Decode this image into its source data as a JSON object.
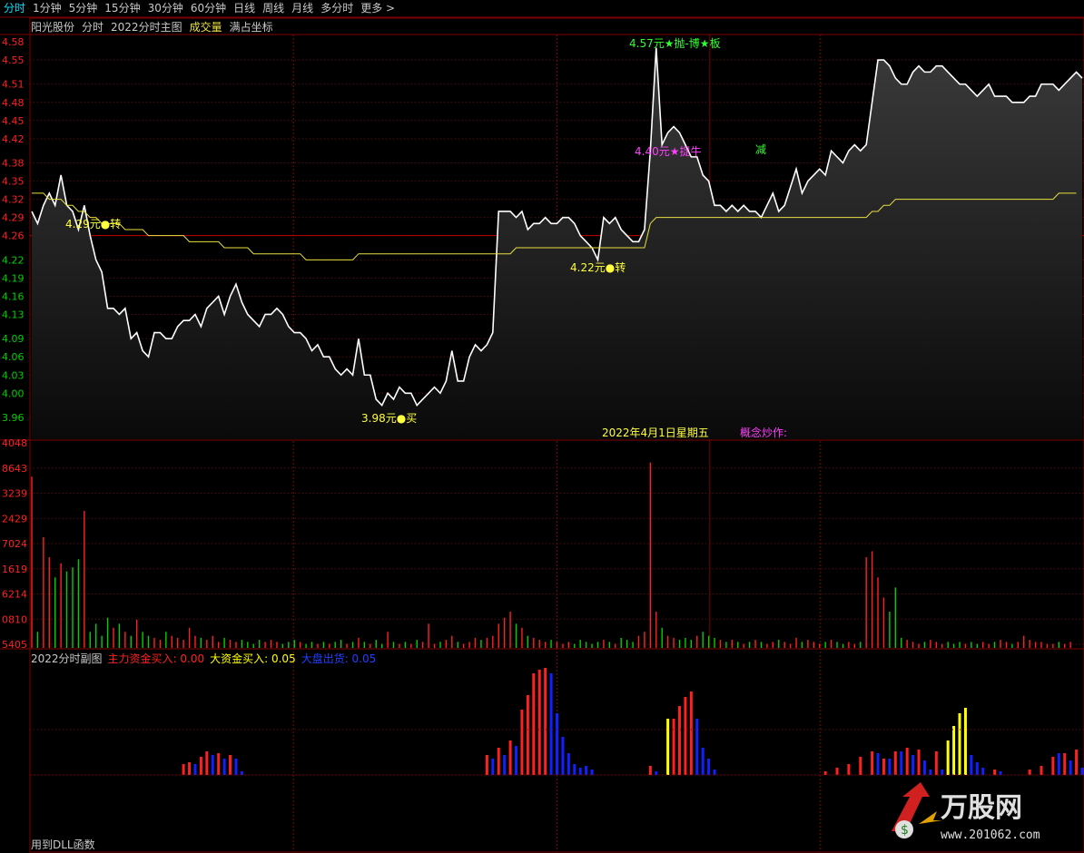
{
  "tabs": [
    {
      "label": "分时",
      "active": true
    },
    {
      "label": "1分钟"
    },
    {
      "label": "5分钟"
    },
    {
      "label": "15分钟"
    },
    {
      "label": "30分钟"
    },
    {
      "label": "60分钟"
    },
    {
      "label": "日线"
    },
    {
      "label": "周线"
    },
    {
      "label": "月线"
    },
    {
      "label": "多分时"
    },
    {
      "label": "更多 >"
    }
  ],
  "title": {
    "stock": "阳光股份",
    "mode": "分时",
    "indicator": "2022分时主图",
    "volume_label": "成交量",
    "coord": "满占坐标"
  },
  "colors": {
    "price_line": "#ffffff",
    "avg_line": "#e8e040",
    "up": "#ff2020",
    "down": "#00d000",
    "grid": "#800000",
    "blue": "#1020ff",
    "yellow": "#ffff00"
  },
  "price_axis": [
    "4.58",
    "4.55",
    "4.51",
    "4.48",
    "4.45",
    "4.42",
    "4.38",
    "4.35",
    "4.32",
    "4.29",
    "4.26",
    "4.22",
    "4.19",
    "4.16",
    "4.13",
    "4.09",
    "4.06",
    "4.03",
    "4.00",
    "3.96"
  ],
  "volume_axis": [
    "4048",
    "8643",
    "3239",
    "2429",
    "7024",
    "1619",
    "6214",
    "0810",
    "5405"
  ],
  "annotations": {
    "a1": "4.29元●转",
    "a2": "3.98元●买",
    "a3": "4.22元●转",
    "a4": "4.57元★抛-博★板",
    "a5": "4.40元★捉牛",
    "a6": "减",
    "date": "2022年4月1日星期五",
    "concept": "概念炒作:"
  },
  "sub": {
    "title": "2022分时副图",
    "main": "主力资金买入: 0.00",
    "big": "大资金买入: 0.05",
    "out": "大盘出货: 0.05"
  },
  "footer": "用到DLL函数",
  "logo": {
    "text": "万股网",
    "url": "www.201062.com"
  },
  "chart_data": {
    "type": "line",
    "price_ylim": [
      3.96,
      4.58
    ],
    "price": [
      4.3,
      4.28,
      4.31,
      4.33,
      4.31,
      4.36,
      4.31,
      4.3,
      4.27,
      4.31,
      4.26,
      4.22,
      4.2,
      4.14,
      4.14,
      4.13,
      4.14,
      4.09,
      4.1,
      4.07,
      4.06,
      4.1,
      4.1,
      4.09,
      4.09,
      4.11,
      4.12,
      4.12,
      4.13,
      4.11,
      4.14,
      4.15,
      4.16,
      4.13,
      4.16,
      4.18,
      4.15,
      4.13,
      4.12,
      4.11,
      4.13,
      4.13,
      4.14,
      4.13,
      4.11,
      4.1,
      4.1,
      4.09,
      4.07,
      4.08,
      4.06,
      4.06,
      4.04,
      4.03,
      4.04,
      4.03,
      4.09,
      4.03,
      4.03,
      3.99,
      3.98,
      4.0,
      3.99,
      4.01,
      4.0,
      4.0,
      3.98,
      3.99,
      4.0,
      4.01,
      4.0,
      4.02,
      4.07,
      4.02,
      4.02,
      4.06,
      4.08,
      4.07,
      4.08,
      4.1,
      4.3,
      4.3,
      4.3,
      4.29,
      4.3,
      4.27,
      4.28,
      4.28,
      4.29,
      4.28,
      4.28,
      4.29,
      4.29,
      4.28,
      4.26,
      4.25,
      4.24,
      4.22,
      4.29,
      4.28,
      4.29,
      4.27,
      4.26,
      4.25,
      4.25,
      4.27,
      4.4,
      4.57,
      4.41,
      4.43,
      4.44,
      4.43,
      4.41,
      4.39,
      4.39,
      4.36,
      4.35,
      4.31,
      4.31,
      4.3,
      4.31,
      4.3,
      4.31,
      4.3,
      4.3,
      4.29,
      4.31,
      4.33,
      4.3,
      4.31,
      4.34,
      4.37,
      4.33,
      4.35,
      4.36,
      4.37,
      4.36,
      4.4,
      4.39,
      4.38,
      4.4,
      4.41,
      4.4,
      4.41,
      4.48,
      4.55,
      4.55,
      4.54,
      4.52,
      4.51,
      4.51,
      4.53,
      4.54,
      4.53,
      4.53,
      4.54,
      4.54,
      4.53,
      4.52,
      4.51,
      4.51,
      4.5,
      4.49,
      4.5,
      4.51,
      4.49,
      4.49,
      4.49,
      4.48,
      4.48,
      4.48,
      4.49,
      4.49,
      4.51,
      4.51,
      4.51,
      4.5,
      4.51,
      4.52,
      4.53,
      4.52
    ],
    "avg": [
      4.33,
      4.33,
      4.33,
      4.32,
      4.32,
      4.32,
      4.31,
      4.31,
      4.3,
      4.3,
      4.29,
      4.29,
      4.28,
      4.28,
      4.28,
      4.28,
      4.27,
      4.27,
      4.27,
      4.27,
      4.26,
      4.26,
      4.26,
      4.26,
      4.26,
      4.26,
      4.26,
      4.25,
      4.25,
      4.25,
      4.25,
      4.25,
      4.25,
      4.24,
      4.24,
      4.24,
      4.24,
      4.24,
      4.23,
      4.23,
      4.23,
      4.23,
      4.23,
      4.23,
      4.23,
      4.23,
      4.23,
      4.22,
      4.22,
      4.22,
      4.22,
      4.22,
      4.22,
      4.22,
      4.22,
      4.22,
      4.23,
      4.23,
      4.23,
      4.23,
      4.23,
      4.23,
      4.23,
      4.23,
      4.23,
      4.23,
      4.23,
      4.23,
      4.23,
      4.23,
      4.23,
      4.23,
      4.23,
      4.23,
      4.23,
      4.23,
      4.23,
      4.23,
      4.23,
      4.23,
      4.23,
      4.23,
      4.23,
      4.24,
      4.24,
      4.24,
      4.24,
      4.24,
      4.24,
      4.24,
      4.24,
      4.24,
      4.24,
      4.24,
      4.24,
      4.24,
      4.24,
      4.24,
      4.24,
      4.24,
      4.24,
      4.24,
      4.24,
      4.24,
      4.24,
      4.24,
      4.28,
      4.29,
      4.29,
      4.29,
      4.29,
      4.29,
      4.29,
      4.29,
      4.29,
      4.29,
      4.29,
      4.29,
      4.29,
      4.29,
      4.29,
      4.29,
      4.29,
      4.29,
      4.29,
      4.29,
      4.29,
      4.29,
      4.29,
      4.29,
      4.29,
      4.29,
      4.29,
      4.29,
      4.29,
      4.29,
      4.29,
      4.29,
      4.29,
      4.29,
      4.29,
      4.29,
      4.29,
      4.29,
      4.3,
      4.3,
      4.31,
      4.31,
      4.32,
      4.32,
      4.32,
      4.32,
      4.32,
      4.32,
      4.32,
      4.32,
      4.32,
      4.32,
      4.32,
      4.32,
      4.32,
      4.32,
      4.32,
      4.32,
      4.32,
      4.32,
      4.32,
      4.32,
      4.32,
      4.32,
      4.32,
      4.32,
      4.32,
      4.32,
      4.32,
      4.32,
      4.33,
      4.33,
      4.33,
      4.33
    ],
    "volume": [
      0.85,
      0.08,
      0.55,
      0.45,
      0.35,
      0.42,
      0.38,
      0.4,
      0.44,
      0.68,
      0.08,
      0.12,
      0.06,
      0.15,
      0.1,
      0.12,
      0.08,
      0.06,
      0.14,
      0.08,
      0.06,
      0.05,
      0.04,
      0.08,
      0.06,
      0.05,
      0.04,
      0.1,
      0.06,
      0.05,
      0.04,
      0.06,
      0.03,
      0.05,
      0.04,
      0.03,
      0.04,
      0.03,
      0.02,
      0.04,
      0.03,
      0.04,
      0.03,
      0.02,
      0.03,
      0.04,
      0.03,
      0.02,
      0.03,
      0.02,
      0.03,
      0.02,
      0.03,
      0.04,
      0.02,
      0.03,
      0.05,
      0.03,
      0.02,
      0.04,
      0.02,
      0.08,
      0.03,
      0.02,
      0.03,
      0.02,
      0.04,
      0.03,
      0.12,
      0.02,
      0.03,
      0.04,
      0.06,
      0.03,
      0.02,
      0.03,
      0.05,
      0.04,
      0.05,
      0.06,
      0.12,
      0.15,
      0.18,
      0.12,
      0.1,
      0.06,
      0.05,
      0.04,
      0.03,
      0.04,
      0.03,
      0.02,
      0.03,
      0.02,
      0.04,
      0.03,
      0.02,
      0.03,
      0.04,
      0.03,
      0.02,
      0.05,
      0.04,
      0.03,
      0.06,
      0.08,
      0.92,
      0.18,
      0.1,
      0.06,
      0.05,
      0.04,
      0.05,
      0.04,
      0.06,
      0.08,
      0.06,
      0.05,
      0.04,
      0.03,
      0.04,
      0.03,
      0.02,
      0.03,
      0.04,
      0.03,
      0.02,
      0.03,
      0.04,
      0.03,
      0.02,
      0.05,
      0.03,
      0.04,
      0.03,
      0.02,
      0.03,
      0.04,
      0.03,
      0.02,
      0.03,
      0.02,
      0.03,
      0.45,
      0.48,
      0.35,
      0.25,
      0.18,
      0.3,
      0.05,
      0.04,
      0.03,
      0.02,
      0.03,
      0.04,
      0.03,
      0.02,
      0.03,
      0.02,
      0.03,
      0.02,
      0.03,
      0.02,
      0.03,
      0.02,
      0.03,
      0.04,
      0.03,
      0.02,
      0.03,
      0.06,
      0.04,
      0.03,
      0.03,
      0.02,
      0.02,
      0.03,
      0.02,
      0.03
    ],
    "sub_bars": {
      "red": [
        {
          "i": 26,
          "h": 12
        },
        {
          "i": 27,
          "h": 14
        },
        {
          "i": 29,
          "h": 20
        },
        {
          "i": 30,
          "h": 26
        },
        {
          "i": 32,
          "h": 24
        },
        {
          "i": 34,
          "h": 22
        },
        {
          "i": 78,
          "h": 22
        },
        {
          "i": 80,
          "h": 30
        },
        {
          "i": 82,
          "h": 38
        },
        {
          "i": 84,
          "h": 72
        },
        {
          "i": 85,
          "h": 88
        },
        {
          "i": 86,
          "h": 112
        },
        {
          "i": 87,
          "h": 116
        },
        {
          "i": 88,
          "h": 118
        },
        {
          "i": 106,
          "h": 10
        },
        {
          "i": 110,
          "h": 62
        },
        {
          "i": 111,
          "h": 76
        },
        {
          "i": 112,
          "h": 86
        },
        {
          "i": 113,
          "h": 92
        },
        {
          "i": 136,
          "h": 4
        },
        {
          "i": 138,
          "h": 8
        },
        {
          "i": 140,
          "h": 12
        },
        {
          "i": 142,
          "h": 20
        },
        {
          "i": 144,
          "h": 26
        },
        {
          "i": 146,
          "h": 18
        },
        {
          "i": 148,
          "h": 26
        },
        {
          "i": 150,
          "h": 30
        },
        {
          "i": 152,
          "h": 28
        },
        {
          "i": 155,
          "h": 26
        },
        {
          "i": 157,
          "h": 6
        },
        {
          "i": 165,
          "h": 6
        },
        {
          "i": 171,
          "h": 6
        },
        {
          "i": 173,
          "h": 10
        },
        {
          "i": 175,
          "h": 20
        },
        {
          "i": 177,
          "h": 24
        },
        {
          "i": 179,
          "h": 28
        },
        {
          "i": 182,
          "h": 4
        }
      ],
      "blue": [
        {
          "i": 28,
          "h": 12
        },
        {
          "i": 31,
          "h": 22
        },
        {
          "i": 33,
          "h": 18
        },
        {
          "i": 35,
          "h": 18
        },
        {
          "i": 36,
          "h": 4
        },
        {
          "i": 79,
          "h": 18
        },
        {
          "i": 81,
          "h": 22
        },
        {
          "i": 83,
          "h": 32
        },
        {
          "i": 89,
          "h": 112
        },
        {
          "i": 90,
          "h": 68
        },
        {
          "i": 91,
          "h": 42
        },
        {
          "i": 92,
          "h": 24
        },
        {
          "i": 93,
          "h": 12
        },
        {
          "i": 94,
          "h": 8
        },
        {
          "i": 95,
          "h": 10
        },
        {
          "i": 96,
          "h": 6
        },
        {
          "i": 107,
          "h": 4
        },
        {
          "i": 114,
          "h": 62
        },
        {
          "i": 115,
          "h": 30
        },
        {
          "i": 116,
          "h": 18
        },
        {
          "i": 117,
          "h": 6
        },
        {
          "i": 145,
          "h": 24
        },
        {
          "i": 147,
          "h": 18
        },
        {
          "i": 149,
          "h": 26
        },
        {
          "i": 151,
          "h": 22
        },
        {
          "i": 153,
          "h": 16
        },
        {
          "i": 154,
          "h": 6
        },
        {
          "i": 156,
          "h": 6
        },
        {
          "i": 160,
          "h": 36
        },
        {
          "i": 161,
          "h": 22
        },
        {
          "i": 162,
          "h": 14
        },
        {
          "i": 163,
          "h": 8
        },
        {
          "i": 166,
          "h": 4
        },
        {
          "i": 176,
          "h": 24
        },
        {
          "i": 178,
          "h": 16
        },
        {
          "i": 180,
          "h": 8
        }
      ],
      "yellow": [
        {
          "i": 109,
          "h": 62
        },
        {
          "i": 157,
          "h": 38
        },
        {
          "i": 158,
          "h": 54
        },
        {
          "i": 159,
          "h": 68
        },
        {
          "i": 160,
          "h": 74
        },
        {
          "i": 183,
          "h": 4
        }
      ]
    }
  }
}
